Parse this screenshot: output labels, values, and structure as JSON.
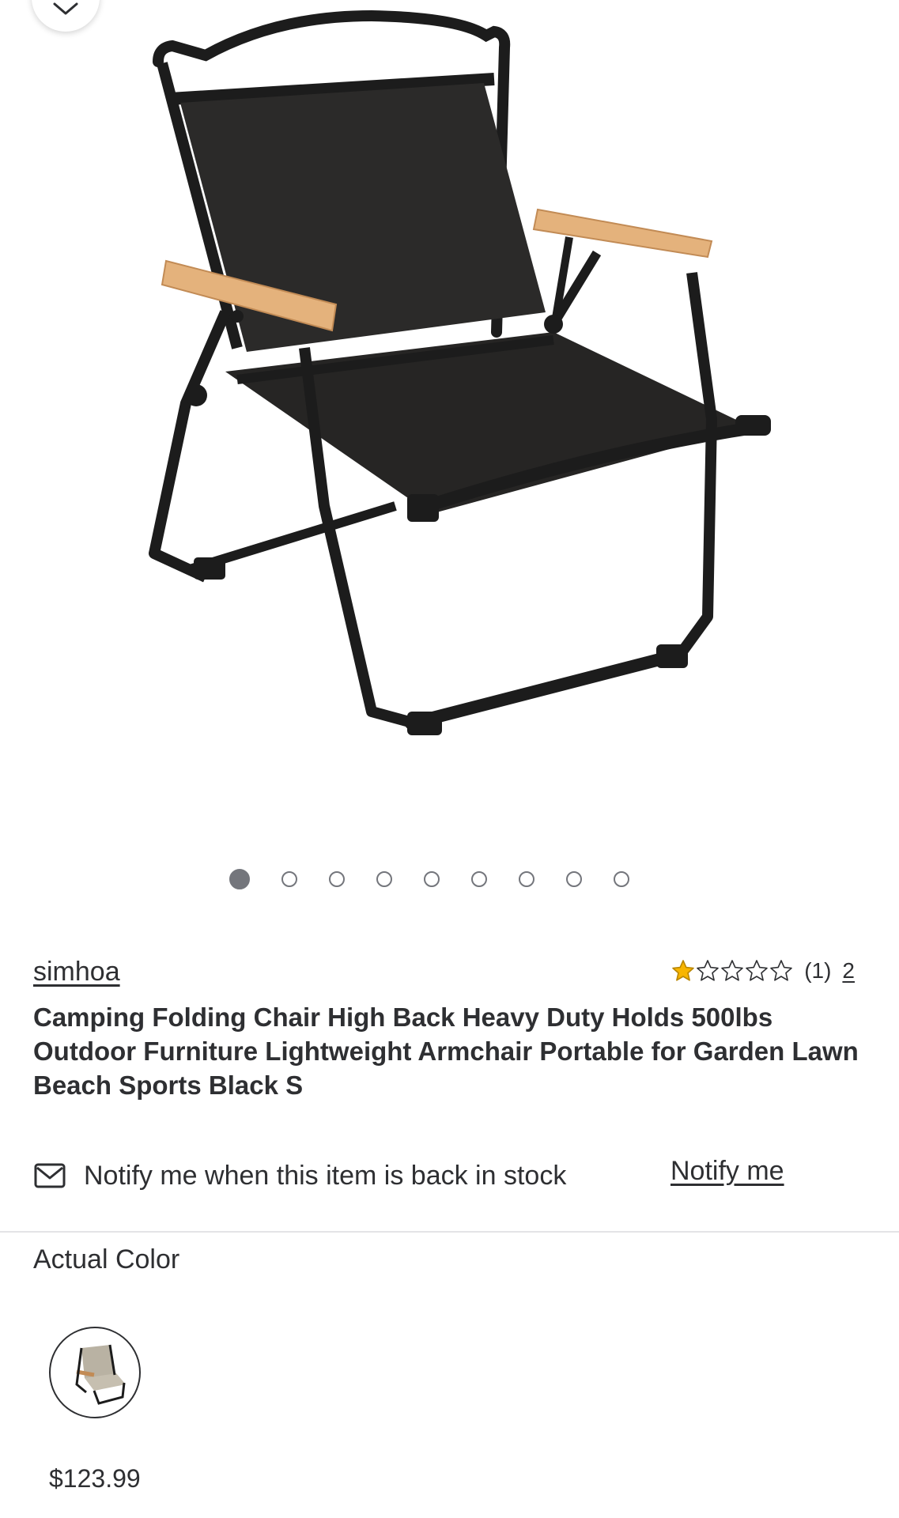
{
  "gallery": {
    "image_alt": "Camping folding chair, black fabric with wooden armrests",
    "dot_count": 9,
    "active_index": 0
  },
  "product": {
    "brand": "simhoa",
    "rating": {
      "stars": 1,
      "max_stars": 5,
      "count_text": "(1)",
      "link_text": "2"
    },
    "title": "Camping Folding Chair High Back Heavy Duty Holds 500lbs Outdoor Furniture Lightweight Armchair Portable for Garden Lawn Beach Sports Black S"
  },
  "stock": {
    "notify_text": "Notify me when this item is back in stock",
    "notify_link": "Notify me"
  },
  "variant": {
    "label": "Actual Color",
    "price": "$123.99"
  },
  "colors": {
    "star": "#f8b500",
    "text": "#2e2f32",
    "dot": "#74767c"
  },
  "icons": {
    "favorite": "chevron-down-icon",
    "mail": "mail-icon",
    "star": "star-icon"
  }
}
